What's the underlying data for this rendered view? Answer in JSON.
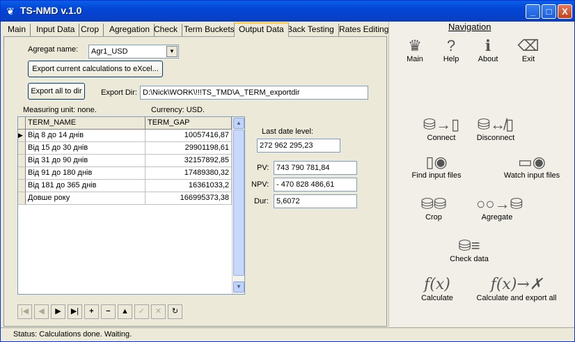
{
  "window": {
    "title": "TS-NMD v.1.0",
    "minimize": "_",
    "maximize": "□",
    "close": "X"
  },
  "tabs": [
    "Main",
    "Input Data",
    "Crop",
    "Agregation",
    "Check",
    "Term Buckets",
    "Output Data",
    "Back Testing",
    "Rates Editing"
  ],
  "active_tab": "Output Data",
  "output": {
    "agregat_label": "Agregat name:",
    "agregat_value": "Agr1_USD",
    "export_excel_label": "Export current calculations to eXcel...",
    "export_all_label": "Export all to dir",
    "export_dir_label": "Export Dir:",
    "export_dir_value": "D:\\Nick\\WORK\\!!!TS_TMD\\A_TERM_exportdir",
    "measuring_unit": "Measuring unit: none.",
    "currency": "Currency: USD."
  },
  "grid": {
    "columns": [
      "TERM_NAME",
      "TERM_GAP"
    ],
    "rows": [
      {
        "name": "Від 8 до 14 днів",
        "gap": "10057416,87"
      },
      {
        "name": "Від 15 до 30 днів",
        "gap": "29901198,61"
      },
      {
        "name": "Від 31 до 90 днів",
        "gap": "32157892,85"
      },
      {
        "name": "Від 91 до 180 днів",
        "gap": "17489380,32"
      },
      {
        "name": "Від 181 до 365 днів",
        "gap": "16361033,2"
      },
      {
        "name": "Довше року",
        "gap": "166995373,38"
      }
    ]
  },
  "metrics": {
    "last_date_label": "Last date level:",
    "last_date_value": "272 962 295,23",
    "pv_label": "PV:",
    "pv_value": "743 790 781,84",
    "npv_label": "NPV:",
    "npv_value": "- 470 828 486,61",
    "dur_label": "Dur:",
    "dur_value": "5,6072"
  },
  "navigator": [
    "|◀",
    "◀",
    "▶",
    "▶|",
    "+",
    "−",
    "▲",
    "✓",
    "✕",
    "↻"
  ],
  "navigation": {
    "title": "Navigation",
    "main": "Main",
    "help": "Help",
    "about": "About",
    "exit": "Exit",
    "connect": "Connect",
    "disconnect": "Disconnect",
    "find_input": "Find input files",
    "watch_input": "Watch input files",
    "crop": "Crop",
    "agregate": "Agregate",
    "check_data": "Check data",
    "calculate": "Calculate",
    "calculate_export": "Calculate and export all"
  },
  "status": "Status:  Calculations done. Waiting."
}
